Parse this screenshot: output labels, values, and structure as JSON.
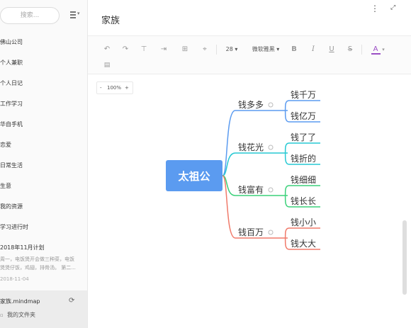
{
  "sidebar": {
    "search_placeholder": "搜索...",
    "items": [
      {
        "label": "佛山公司"
      },
      {
        "label": "个人兼职"
      },
      {
        "label": "个人日记"
      },
      {
        "label": "工作学习"
      },
      {
        "label": "华自手机"
      },
      {
        "label": "恋爱"
      },
      {
        "label": "日常生活"
      },
      {
        "label": "生意"
      },
      {
        "label": "我的资源"
      },
      {
        "label": "学习进行时"
      }
    ],
    "plan": {
      "title": "2018年11月计划",
      "line1": "周一，电饭煲开会做三种菜，电饭",
      "line2": "煲煲仔饭，鸡翅，排骨汤。 第二...",
      "date": "2018-11-04"
    },
    "active_file": {
      "name": "家族.mindmap",
      "folder": "我的文件夹"
    }
  },
  "main": {
    "title": "家族",
    "toolbar": {
      "font_size": "28",
      "font_name": "微软雅黑",
      "bold": "B",
      "italic": "I",
      "underline": "U",
      "strike": "S",
      "font_color": "A",
      "accent_color": "#9b4fc4"
    },
    "zoom": {
      "minus": "-",
      "level": "100%",
      "plus": "+"
    },
    "mindmap": {
      "root": "太祖公",
      "root_color": "#5b9bf0",
      "branches": [
        {
          "label": "钱多多",
          "color": "#5b9bf0",
          "children": [
            "钱千万",
            "钱亿万"
          ]
        },
        {
          "label": "钱花光",
          "color": "#27c9d3",
          "children": [
            "钱了了",
            "钱折的"
          ]
        },
        {
          "label": "钱富有",
          "color": "#3bd17a",
          "children": [
            "钱细细",
            "钱长长"
          ]
        },
        {
          "label": "钱百万",
          "color": "#f07a6a",
          "children": [
            "钱小小",
            "钱大大"
          ]
        }
      ]
    }
  }
}
